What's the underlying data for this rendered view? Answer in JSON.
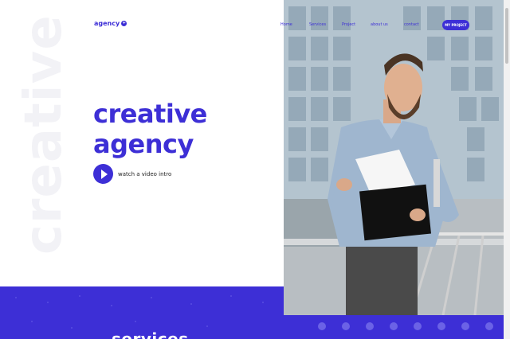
{
  "logo": {
    "text": "agency",
    "badge": "+"
  },
  "watermark": "creative",
  "nav": {
    "items": [
      {
        "label": "Home"
      },
      {
        "label": "Services"
      },
      {
        "label": "Project"
      },
      {
        "label": "about us"
      },
      {
        "label": "contact"
      }
    ],
    "cta_label": "MY PROJECT"
  },
  "hero": {
    "title_line1": "creative",
    "title_line2": "agency",
    "video_label": "watch a video intro"
  },
  "services": {
    "title": "services"
  },
  "colors": {
    "accent": "#3d2fd6",
    "text": "#222222",
    "background": "#ffffff"
  }
}
